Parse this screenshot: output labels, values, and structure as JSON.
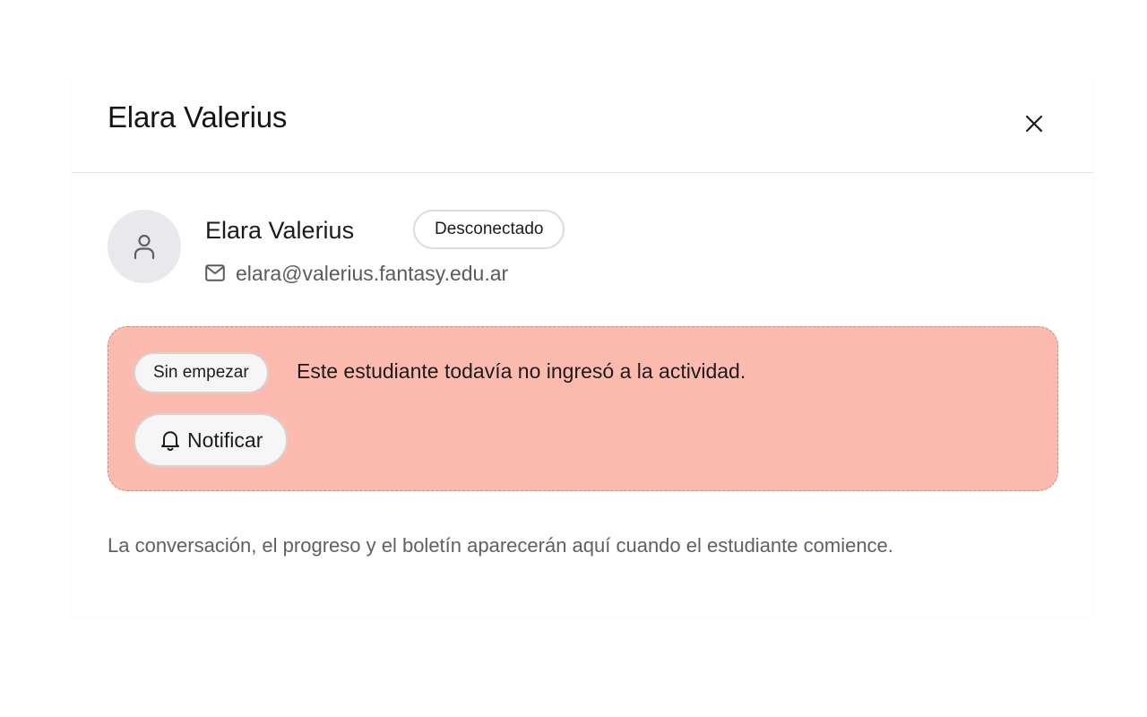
{
  "header": {
    "title": "Elara Valerius",
    "close_icon": "close-icon"
  },
  "student": {
    "name": "Elara Valerius",
    "status": "Desconectado",
    "email": "elara@valerius.fantasy.edu.ar",
    "avatar_icon": "user-icon",
    "email_icon": "mail-icon"
  },
  "alert": {
    "status_label": "Sin empezar",
    "message": "Este estudiante todavía no ingresó a la actividad.",
    "notify_label": "Notificar",
    "notify_icon": "bell-icon",
    "background_color": "#fdbbaf"
  },
  "footer": {
    "note": "La conversación, el progreso y el boletín aparecerán aquí cuando el estudiante comience."
  }
}
